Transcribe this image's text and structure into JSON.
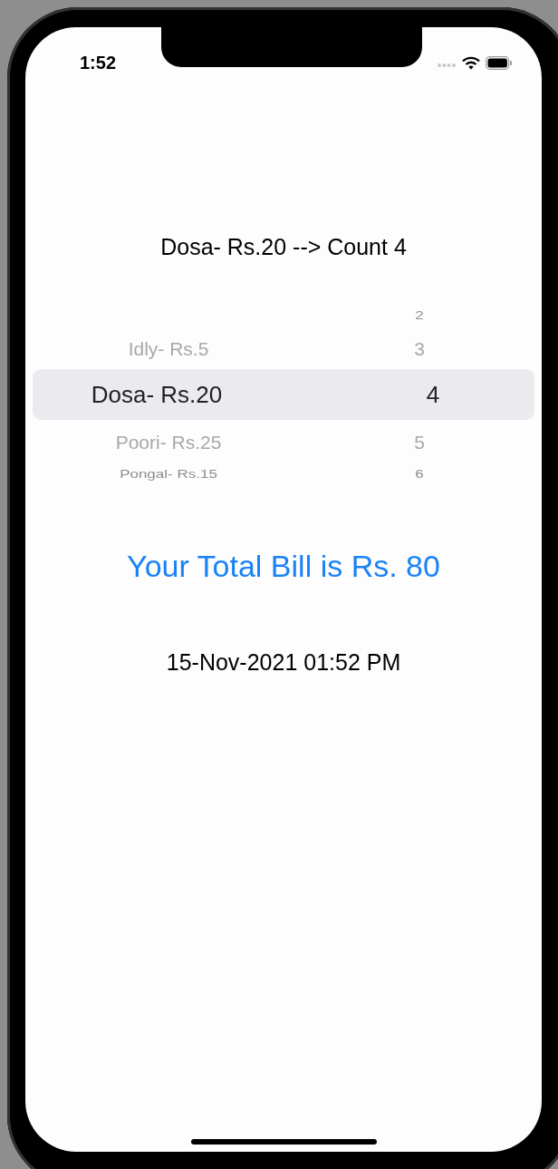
{
  "status_bar": {
    "time": "1:52"
  },
  "heading": "Dosa- Rs.20 --> Count 4",
  "picker": {
    "columns": [
      {
        "items": [
          {
            "label": "Idly- Rs.5",
            "selected": false
          },
          {
            "label": "Dosa- Rs.20",
            "selected": true
          },
          {
            "label": "Poori- Rs.25",
            "selected": false
          },
          {
            "label": "Pongal- Rs.15",
            "selected": false
          }
        ]
      },
      {
        "items": [
          {
            "label": "2",
            "selected": false
          },
          {
            "label": "3",
            "selected": false
          },
          {
            "label": "4",
            "selected": true
          },
          {
            "label": "5",
            "selected": false
          },
          {
            "label": "6",
            "selected": false
          }
        ]
      }
    ]
  },
  "total": "Your Total Bill is Rs. 80",
  "timestamp": "15-Nov-2021 01:52 PM"
}
